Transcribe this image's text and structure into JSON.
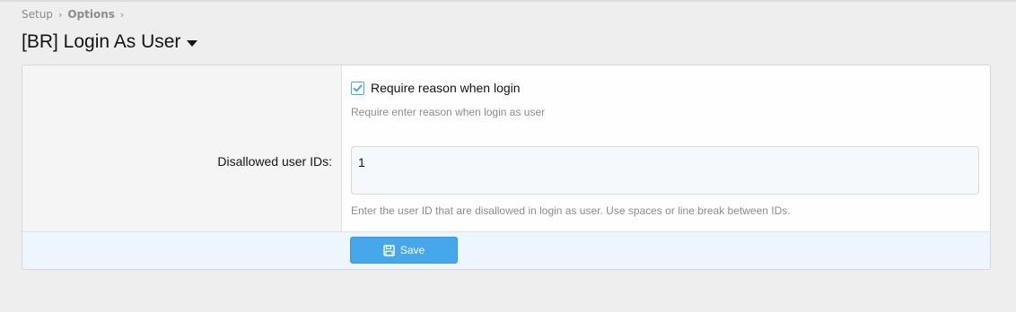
{
  "breadcrumb": {
    "items": [
      "Setup",
      "Options"
    ]
  },
  "page": {
    "title": "[BR] Login As User"
  },
  "options": {
    "require_reason": {
      "label": "Require reason when login",
      "checked": true,
      "hint": "Require enter reason when login as user"
    },
    "disallowed_user_ids": {
      "label": "Disallowed user IDs:",
      "value": "1",
      "hint": "Enter the user ID that are disallowed in login as user. Use spaces or line break between IDs."
    }
  },
  "footer": {
    "save_label": "Save",
    "save_icon": "save-icon"
  },
  "colors": {
    "accent": "#47a7eb",
    "footer_bg": "#edf6fd",
    "page_bg": "#eeeeee"
  }
}
